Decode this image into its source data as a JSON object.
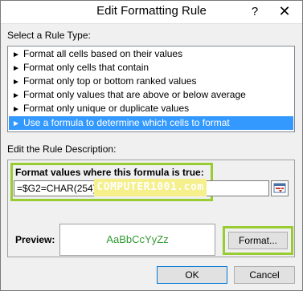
{
  "window": {
    "title": "Edit Formatting Rule",
    "help_label": "?",
    "close_label": "✕"
  },
  "rule_type": {
    "label": "Select a Rule Type:",
    "items": [
      {
        "label": "Format all cells based on their values"
      },
      {
        "label": "Format only cells that contain"
      },
      {
        "label": "Format only top or bottom ranked values"
      },
      {
        "label": "Format only values that are above or below average"
      },
      {
        "label": "Format only unique or duplicate values"
      },
      {
        "label": "Use a formula to determine which cells to format"
      }
    ],
    "selected_index": 5,
    "arrow_glyph": "►"
  },
  "description": {
    "label": "Edit the Rule Description:",
    "formula_label": "Format values where this formula is true:",
    "formula_value": "=$G2=CHAR(254)",
    "watermark": "COMPUTER1001.com",
    "preview_label": "Preview:",
    "preview_text": "AaBbCcYyZz",
    "format_button": "Format..."
  },
  "buttons": {
    "ok": "OK",
    "cancel": "Cancel"
  },
  "colors": {
    "highlight": "#99cc33",
    "selection": "#3399ff",
    "preview_text": "#339933",
    "watermark_bg": "#f5ef8c"
  },
  "icons": {
    "help": "help-icon",
    "close": "close-icon",
    "collapse": "collapse-dialog-icon",
    "arrow": "arrow-right-icon"
  }
}
